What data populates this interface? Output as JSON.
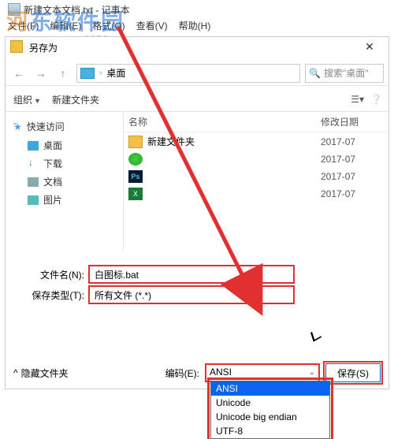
{
  "notepad": {
    "title": "新建文本文档.txt - 记事本",
    "menu": {
      "file": "文件(F)",
      "edit": "编辑(E)",
      "format": "格式(O)",
      "view": "查看(V)",
      "help": "帮助(H)"
    }
  },
  "watermark": {
    "text_cn": "河东软件园",
    "url": "www.pc0359.cn"
  },
  "saveas": {
    "title": "另存为",
    "nav": {
      "location": "桌面",
      "search_placeholder": "搜索\"桌面\""
    },
    "toolbar": {
      "organize": "组织",
      "new_folder": "新建文件夹"
    },
    "sidebar": {
      "quick_access": "快速访问",
      "items": [
        "桌面",
        "下载",
        "文档",
        "图片"
      ]
    },
    "columns": {
      "name": "名称",
      "date": "修改日期"
    },
    "rows": [
      {
        "icon": "folder",
        "name": "新建文件夹",
        "date": "2017-07"
      },
      {
        "icon": "360",
        "name": "",
        "date": "2017-07"
      },
      {
        "icon": "ps",
        "name": "",
        "date": "2017-07"
      },
      {
        "icon": "xls",
        "name": "",
        "date": "2017-07"
      }
    ],
    "form": {
      "filename_label": "文件名(N):",
      "filename_value": "白图标.bat",
      "filetype_label": "保存类型(T):",
      "filetype_value": "所有文件 (*.*)"
    },
    "footer": {
      "hide_folders": "隐藏文件夹",
      "encoding_label": "编码(E):",
      "encoding_value": "ANSI",
      "save_button": "保存(S)",
      "encoding_options": [
        "ANSI",
        "Unicode",
        "Unicode big endian",
        "UTF-8"
      ]
    }
  }
}
